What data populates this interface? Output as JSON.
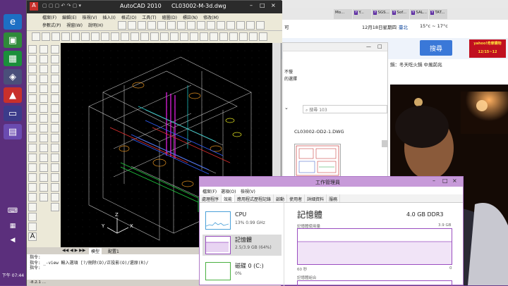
{
  "taskbar": {
    "clock": "下午 07:44"
  },
  "browser": {
    "tabs": [
      "Mo...",
      "Y...",
      "SGS...",
      "Sof...",
      "SAL...",
      "TAT..."
    ],
    "tab_fragment": "可",
    "date": "12月18日星期四",
    "weather_loc": "臺北",
    "weather": "15°c ~ 17°c",
    "search_button": "搜尋",
    "ad_text": "yahoo!奇摩購物",
    "ad_date": "12/15~12",
    "headline": "鍋：冬天吃火鍋  中風前兆"
  },
  "explorer": {
    "snippets": [
      "不慢",
      "的選擇"
    ],
    "search_placeholder": "搜尋 103",
    "file_name": "CL03002-OD2-1.DWG"
  },
  "autocad": {
    "app": "AutoCAD 2010",
    "file": "CL03002-M-3d.dwg",
    "menu_row1": [
      "檔案(F)",
      "編輯(E)",
      "檢視(V)",
      "插入(I)",
      "格式(O)",
      "工具(T)",
      "繪圖(D)",
      "標註(N)",
      "修改(M)"
    ],
    "menu_row2": [
      "參數式(P)",
      "視窗(W)",
      "說明(H)"
    ],
    "tabs": [
      "模型",
      "配置1"
    ],
    "cmd_line1": "指令:",
    "cmd_line2": "指令: _-view 輸入選項 [?/刪除(D)/正投影(O)/還原(R)/",
    "cmd_line3": "指令:",
    "status": "-8.2.1 ..."
  },
  "task_manager": {
    "title": "工作管理員",
    "menu": [
      "檔案(F)",
      "選項(O)",
      "檢視(V)"
    ],
    "tabs": [
      "處理程序",
      "效能",
      "應用程式歷程記錄",
      "啟動",
      "使用者",
      "詳細資料",
      "服務"
    ],
    "items": [
      {
        "name": "CPU",
        "value": "13%  0.99 GHz"
      },
      {
        "name": "記憶體",
        "value": "2.5/3.9 GB (64%)"
      },
      {
        "name": "磁碟 0 (C:)",
        "value": "0%"
      }
    ],
    "memory_title": "記憶體",
    "memory_spec": "4.0 GB DDR3",
    "usage_label": "記憶體使用量",
    "max_label": "3.9 GB",
    "seconds_label": "60 秒",
    "zero_label": "0",
    "composition_label": "記憶體組合"
  },
  "colors": {
    "taskbar": "#5b2f7c",
    "tm_title": "#c79ad9",
    "acad_canvas": "#000000"
  }
}
